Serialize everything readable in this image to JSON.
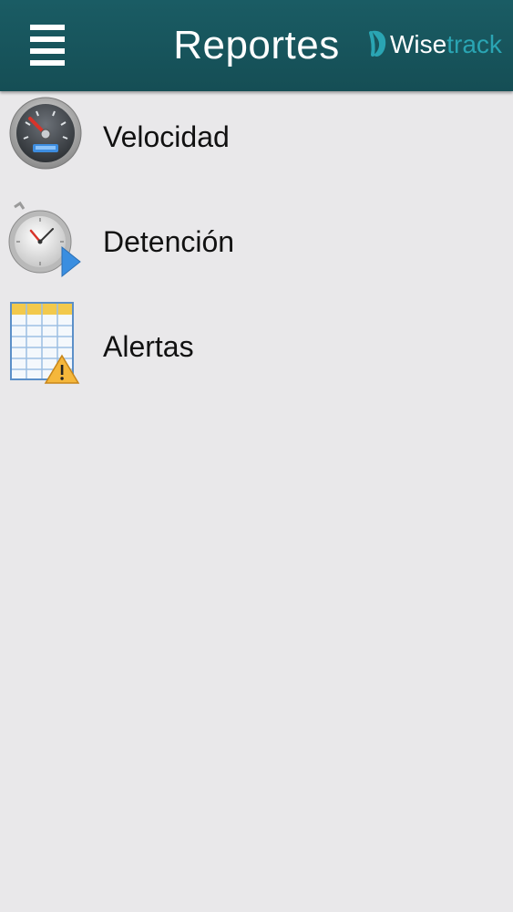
{
  "header": {
    "title": "Reportes",
    "logo": {
      "part1": "Wise",
      "part2": "track"
    },
    "background": "#1a5c64"
  },
  "menu": {
    "items": [
      {
        "label": "Velocidad",
        "icon": "speedometer-icon"
      },
      {
        "label": "Detención",
        "icon": "stopwatch-play-icon"
      },
      {
        "label": "Alertas",
        "icon": "table-warning-icon"
      }
    ]
  }
}
